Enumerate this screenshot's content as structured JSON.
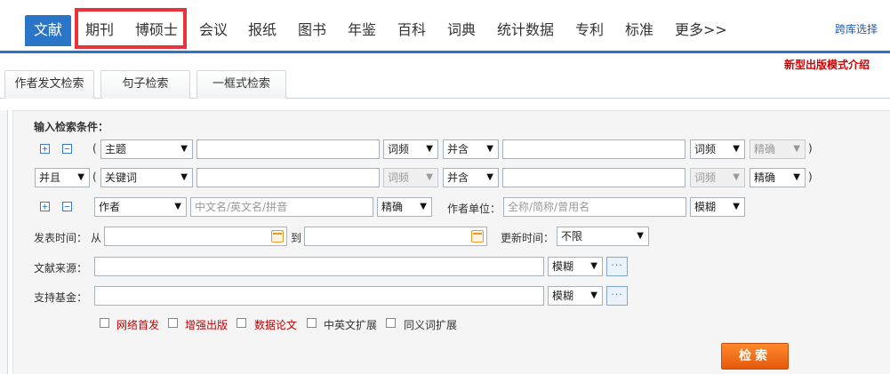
{
  "nav": {
    "items": [
      "文献",
      "期刊",
      "博硕士",
      "会议",
      "报纸",
      "图书",
      "年鉴",
      "百科",
      "词典",
      "统计数据",
      "专利",
      "标准",
      "更多>>"
    ],
    "cross_lib": "跨库选择"
  },
  "promo": "新型出版模式介绍",
  "tabs": [
    "作者发文检索",
    "句子检索",
    "一框式检索"
  ],
  "panel": {
    "title": "输入检索条件：",
    "row1": {
      "field": "主题",
      "freq1": "词频",
      "combine": "并含",
      "freq2": "词频",
      "match": "精确"
    },
    "row2": {
      "logic": "并且",
      "field": "关键词",
      "freq1": "词频",
      "combine": "并含",
      "freq2": "词频",
      "match": "精确"
    },
    "row3": {
      "field": "作者",
      "name_placeholder": "中文名/英文名/拼音",
      "match": "精确",
      "unit_label": "作者单位：",
      "unit_placeholder": "全称/简称/曾用名",
      "unit_match": "模糊"
    },
    "time": {
      "label": "发表时间：",
      "from": "从",
      "to": "到",
      "update_label": "更新时间：",
      "update_value": "不限"
    },
    "source": {
      "label": "文献来源：",
      "match": "模糊"
    },
    "fund": {
      "label": "支持基金：",
      "match": "模糊"
    },
    "paren_open": "(",
    "paren_close": ")",
    "dots": "···",
    "checkboxes": [
      "网络首发",
      "增强出版",
      "数据论文",
      "中英文扩展",
      "同义词扩展"
    ],
    "search_label": "检索"
  },
  "colors": {
    "accent": "#2a75c7",
    "highlight": "#e8333c",
    "search": "#f07118",
    "promo": "#d40000"
  }
}
